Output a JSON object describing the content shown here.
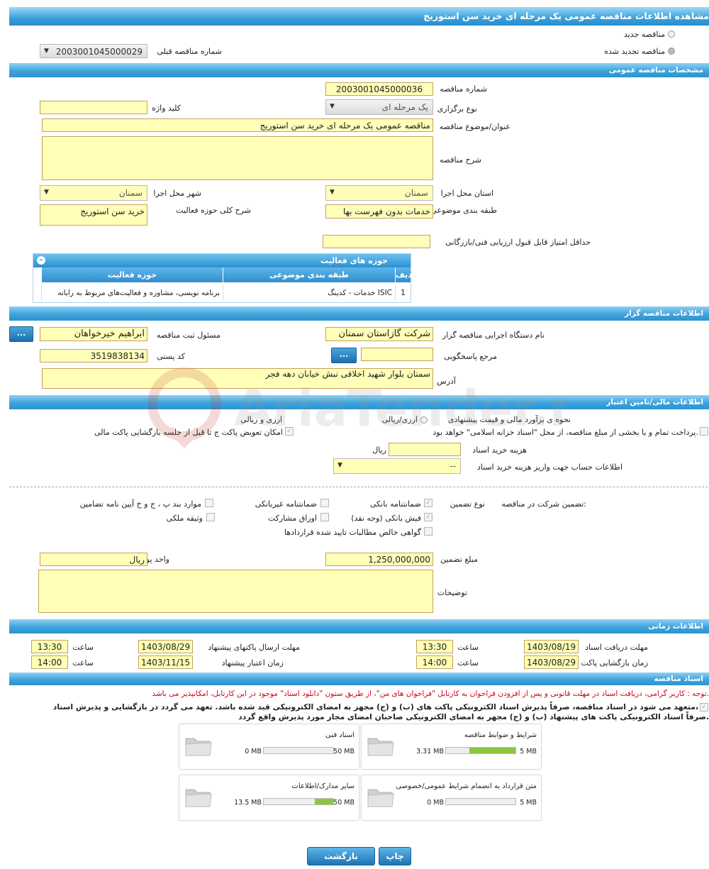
{
  "title": "مشاهده اطلاعات مناقصه عمومی یک مرحله ای خرید سن استوریج",
  "tender_type": {
    "new_label": "مناقصه جدید",
    "renewed_label": "مناقصه تجدید شده",
    "prev_number_label": "شماره مناقصه قبلی",
    "prev_number": "2003001045000029"
  },
  "sections": {
    "general": "مشخصات مناقصه عمومی",
    "organizer": "اطلاعات مناقصه گزار",
    "finance": "اطلاعات مالی/تامین اعتبار",
    "timing": "اطلاعات زمانی",
    "documents": "اسناد مناقصه"
  },
  "general": {
    "number_label": "شماره مناقصه",
    "number": "2003001045000036",
    "holding_label": "نوع برگزاری",
    "holding": "یک مرحله ای",
    "keyword_label": "کلید واژه",
    "keyword": "",
    "subject_label": "عنوان/موضوع مناقصه",
    "subject": "مناقصه عمومی یک مرحله ای خرید سن استوریج",
    "desc_label": "شرح مناقصه",
    "desc": "",
    "province_label": "استان محل اجرا",
    "province": "سمنان",
    "city_label": "شهر محل اجرا",
    "city": "سمنان",
    "category_label": "طبقه بندی موضوعی",
    "category": "خدمات بدون فهرست بها",
    "scope_label": "شرح کلی حوزه فعالیت",
    "scope": "خرید سن استوریج",
    "min_score_label": "حداقل امتیاز قابل قبول ارزیابی فنی/بازرگانی",
    "min_score": ""
  },
  "activity_table": {
    "caption": "حوزه های فعالیت",
    "headers": [
      "ردیف",
      "طبقه بندی موضوعی",
      "حوزه فعالیت"
    ],
    "rows": [
      [
        "1",
        "خدمات - کدینگ ISIC",
        "برنامه نویسی، مشاوره و فعالیت‌های مربوط به رایانه"
      ]
    ]
  },
  "organizer": {
    "agency_label": "نام دستگاه اجرایی مناقصه گزار",
    "agency": "شرکت گازاستان سمنان",
    "registrar_label": "مسئول ثبت مناقصه",
    "registrar": "ابراهیم خیرخواهان",
    "ref_label": "مرجع پاسخگویی",
    "ref": "",
    "postal_label": "کد پستی",
    "postal": "3519838134",
    "address_label": "آدرس",
    "address": "سمنان بلوار شهید اخلاقی نبش خیابان دهه فجر",
    "dots": "..."
  },
  "finance": {
    "estimate_label": "نحوه ی برآورد مالی و قیمت پیشنهادی",
    "opt_rial_fx": "ارزی/ریالی",
    "opt_fx_rial": "ارزی و ریالی",
    "payment_note": "پرداخت تمام و یا بخشی از مبلغ مناقصه، از محل \"اسناد خزانه اسلامی\" خواهد بود.",
    "swap_note": "امکان تعویض پاکت ج تا قبل از جلسه بازگشایی پاکت مالی",
    "doc_cost_label": "هزینه خرید اسناد",
    "doc_cost": "",
    "doc_cost_unit": "ریال",
    "account_label": "اطلاعات حساب جهت واریز هزینه خرید اسناد",
    "account": "--"
  },
  "guarantee": {
    "label": "تضمین شرکت در مناقصه:",
    "type_label": "نوع تضمین",
    "opts": [
      "ضمانتنامه بانکی",
      "ضمانتنامه غیربانکی",
      "موارد بند پ ، ج و خ آیین نامه تضامین",
      "فیش بانکی (وجه نقد)",
      "اوراق مشارکت",
      "وثیقه ملکی",
      "گواهی خالص مطالبات تایید شده قراردادها"
    ],
    "amount_label": "مبلغ تضمین",
    "amount": "1,250,000,000",
    "currency_label": "واحد پول",
    "currency": "ریال",
    "notes_label": "توضیحات",
    "notes": ""
  },
  "timing": {
    "receive_label": "مهلت دریافت اسناد",
    "receive_date": "1403/08/19",
    "receive_time": "13:30",
    "send_label": "مهلت ارسال پاکتهای پیشنهاد",
    "send_date": "1403/08/29",
    "send_time": "13:30",
    "open_label": "زمان بازگشایی پاکت ها",
    "open_date": "1403/08/29",
    "open_time": "14:00",
    "valid_label": "زمان اعتبار پیشنهاد",
    "valid_date": "1403/11/15",
    "valid_time": "14:00",
    "time_label": "ساعت"
  },
  "documents": {
    "note": "توجه : کاربر گرامی، دریافت اسناد در مهلت قانونی و پس از افزودن فراخوان به کارتابل \"فراخوان های من\"، از طریق ستون \"دانلود اسناد\" موجود در این کارتابل، امکانپذیر می باشد.",
    "commit1": "متعهد می شود در اسناد مناقصه، صرفاً پذیرش اسناد الکترونیکی پاکت های (ب) و (ج) مجهز به امضای الکترونیکی قید شده باشد. تعهد می گردد در بازگشایی و پذیرش اسناد،",
    "commit2": "صرفاً اسناد الکترونیکی پاکت های پیشنهاد (ب) و (ج) مجهز به امضای الکترونیکی صاحبان امضای مجاز مورد پذیرش واقع گردد.",
    "cards": [
      {
        "title": "شرایط و ضوابط مناقصه",
        "used": "3.31 MB",
        "max": "5 MB",
        "fill": 0.66
      },
      {
        "title": "اسناد فنی",
        "used": "0 MB",
        "max": "50 MB",
        "fill": 0
      },
      {
        "title": "متن قرارداد به انضمام شرایط عمومی/خصوصی",
        "used": "0 MB",
        "max": "5 MB",
        "fill": 0
      },
      {
        "title": "سایر مدارک/اطلاعات",
        "used": "13.5 MB",
        "max": "50 MB",
        "fill": 0.27
      }
    ]
  },
  "actions": {
    "print": "چاپ",
    "back": "بازگشت"
  },
  "colors": {
    "input_bg": "#ffffb8",
    "bar": "#3ea3dc",
    "progress": "#8cc63f",
    "note": "#d0021b"
  }
}
